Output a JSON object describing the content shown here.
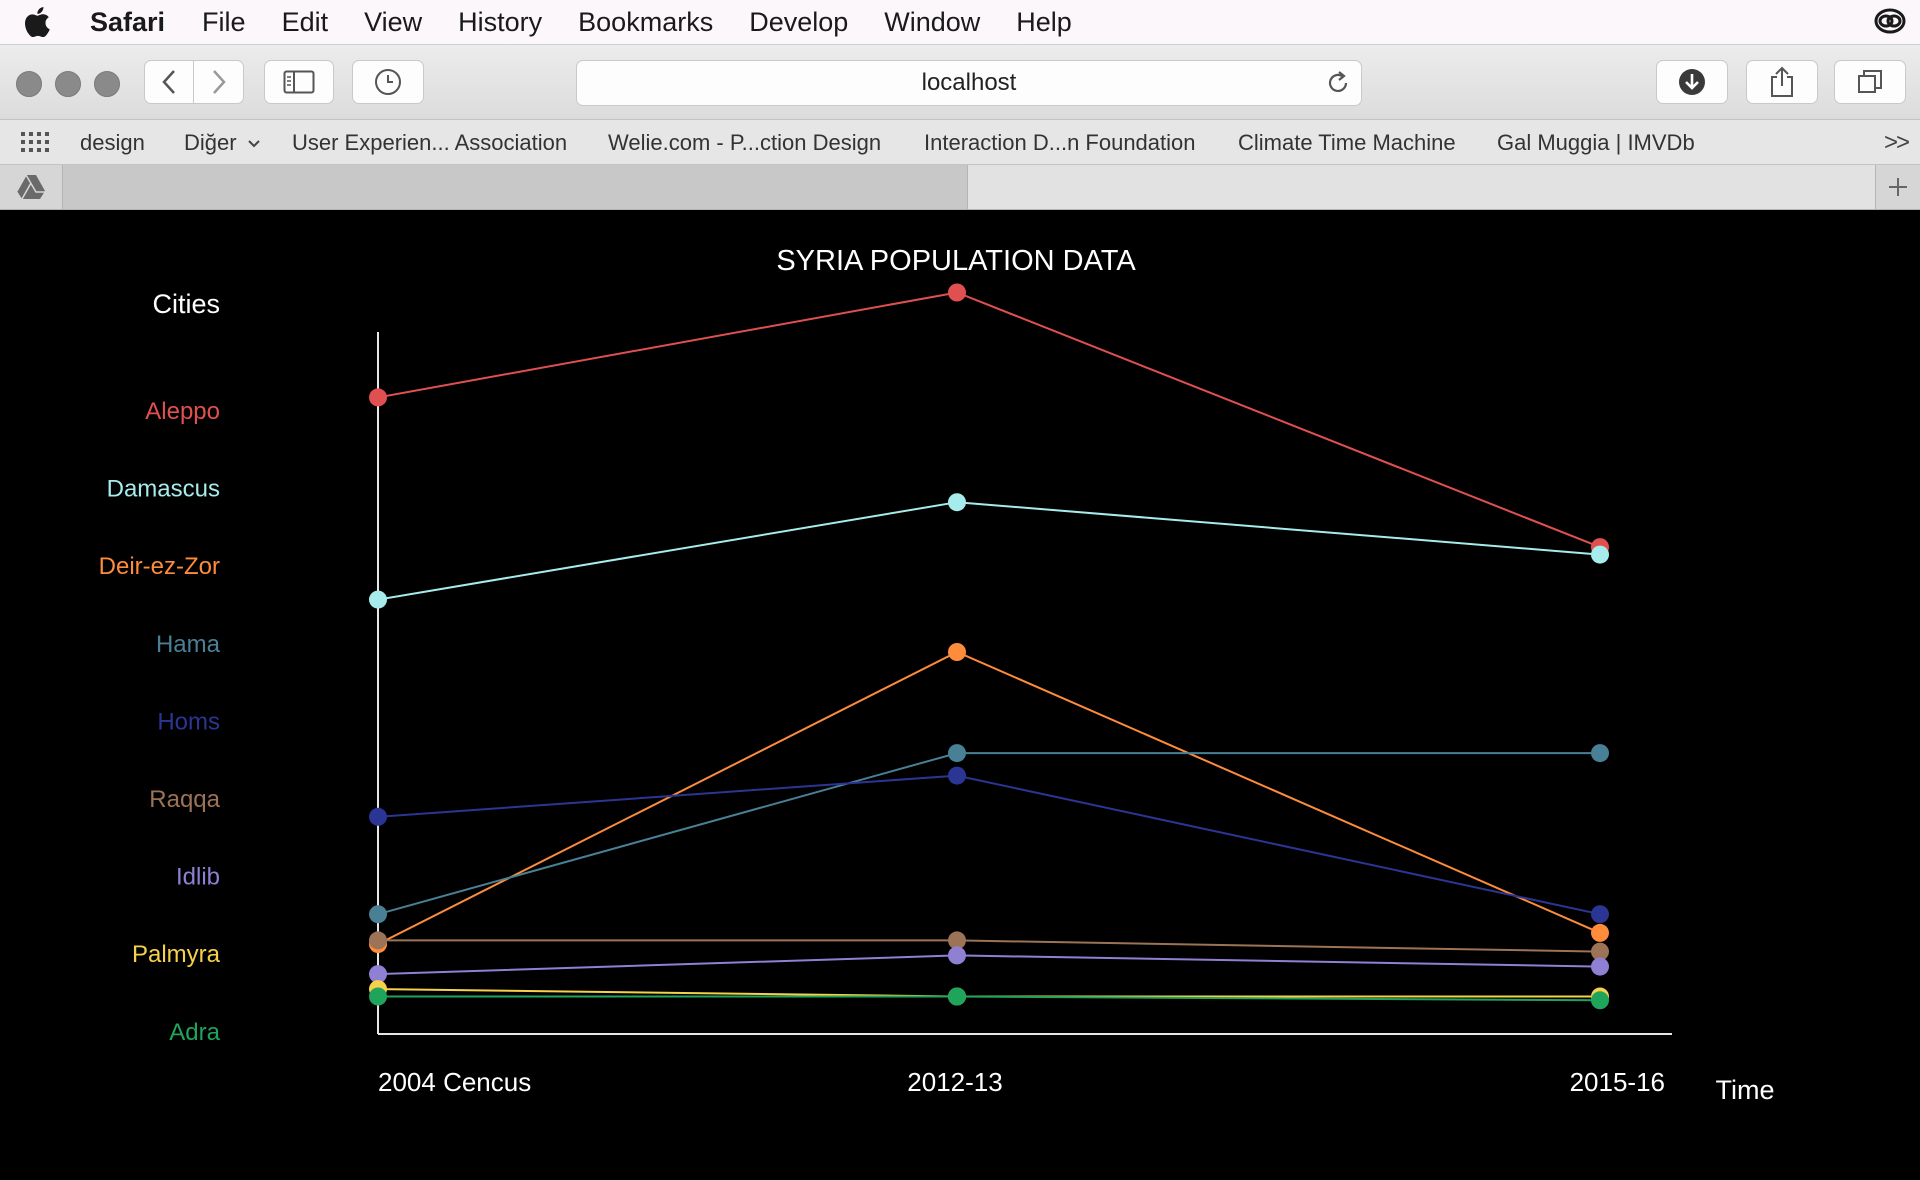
{
  "menubar": {
    "app_name": "Safari",
    "items": [
      "File",
      "Edit",
      "View",
      "History",
      "Bookmarks",
      "Develop",
      "Window",
      "Help"
    ]
  },
  "toolbar": {
    "url": "localhost"
  },
  "bookmarks": {
    "items": [
      "design",
      "Diğer",
      "User Experien... Association",
      "Welie.com - P...ction Design",
      "Interaction D...n Foundation",
      "Climate Time Machine",
      "Gal Muggia | IMVDb"
    ],
    "more": ">>"
  },
  "chart_data": {
    "type": "line",
    "title": "SYRIA POPULATION DATA",
    "legend_title": "Cities",
    "xlabel": "Time",
    "x": [
      "2004 Cencus",
      "2012-13",
      "2015-16"
    ],
    "ylim": [
      0,
      100
    ],
    "grid": false,
    "series": [
      {
        "name": "Aleppo",
        "color": "#e05050",
        "values": [
          85,
          99,
          65
        ]
      },
      {
        "name": "Damascus",
        "color": "#a7ecec",
        "values": [
          58,
          71,
          64
        ]
      },
      {
        "name": "Deir-ez-Zor",
        "color": "#ff8c3a",
        "values": [
          12,
          51,
          13.5
        ]
      },
      {
        "name": "Hama",
        "color": "#4a8096",
        "values": [
          16,
          37.5,
          37.5
        ]
      },
      {
        "name": "Homs",
        "color": "#2b3594",
        "values": [
          29,
          34.5,
          16
        ]
      },
      {
        "name": "Raqqa",
        "color": "#9c7356",
        "values": [
          12.5,
          12.5,
          11
        ]
      },
      {
        "name": "Idlib",
        "color": "#8f80d4",
        "values": [
          8,
          10.5,
          9
        ]
      },
      {
        "name": "Palmyra",
        "color": "#f5d24a",
        "values": [
          6,
          5,
          5
        ]
      },
      {
        "name": "Adra",
        "color": "#1fa45c",
        "values": [
          5,
          5,
          4.5
        ]
      }
    ]
  }
}
